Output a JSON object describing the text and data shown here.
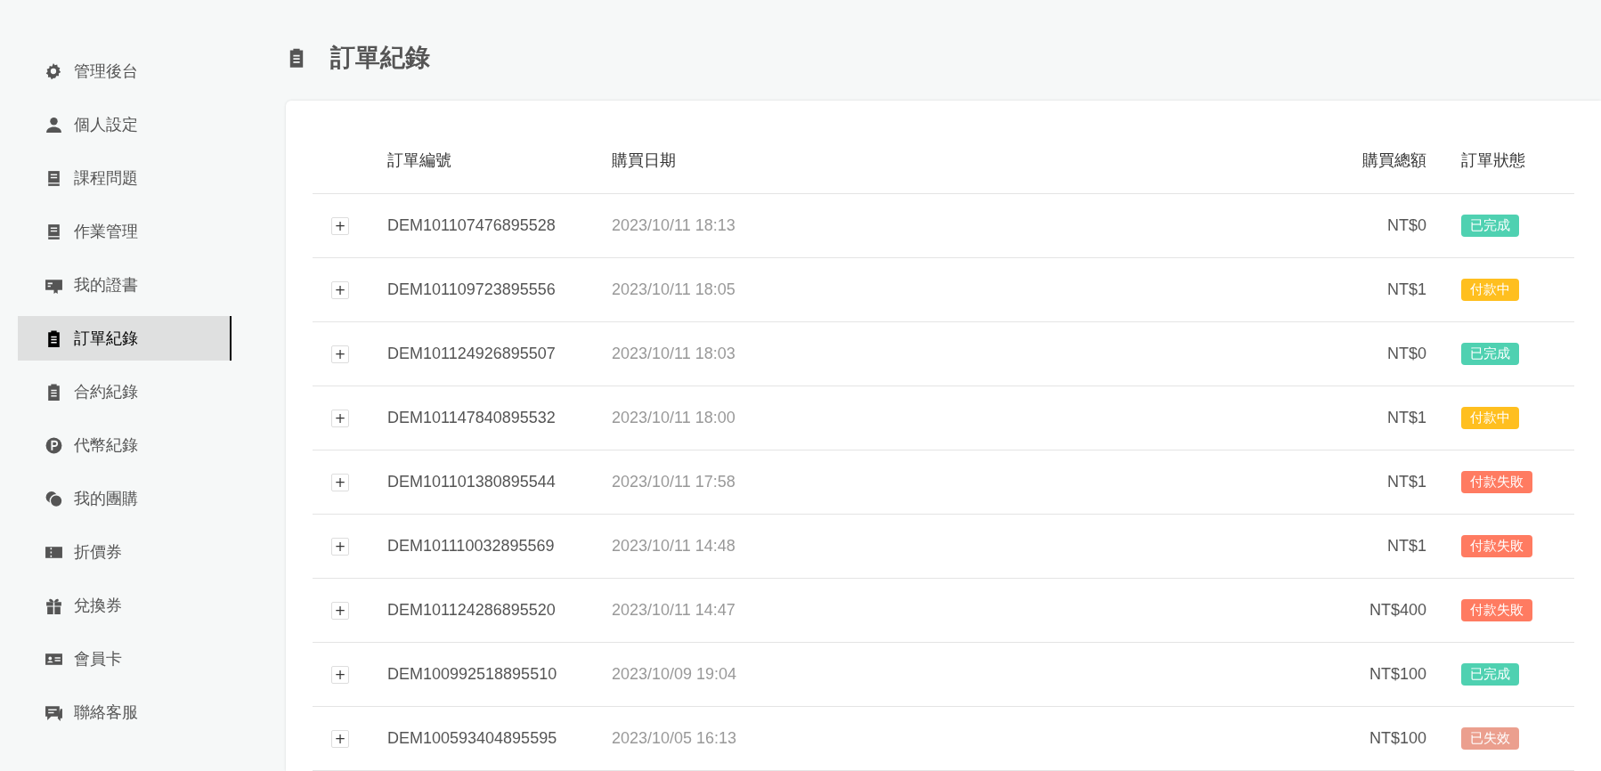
{
  "sidebar": {
    "items": [
      {
        "label": "管理後台",
        "selected": false
      },
      {
        "label": "個人設定",
        "selected": false
      },
      {
        "label": "課程問題",
        "selected": false
      },
      {
        "label": "作業管理",
        "selected": false
      },
      {
        "label": "我的證書",
        "selected": false
      },
      {
        "label": "訂單紀錄",
        "selected": true
      },
      {
        "label": "合約紀錄",
        "selected": false
      },
      {
        "label": "代幣紀錄",
        "selected": false
      },
      {
        "label": "我的團購",
        "selected": false
      },
      {
        "label": "折價券",
        "selected": false
      },
      {
        "label": "兌換券",
        "selected": false
      },
      {
        "label": "會員卡",
        "selected": false
      },
      {
        "label": "聯絡客服",
        "selected": false
      }
    ]
  },
  "page": {
    "title": "訂單紀錄"
  },
  "table": {
    "columns": [
      "訂單編號",
      "購買日期",
      "購買總額",
      "訂單狀態"
    ],
    "rows": [
      {
        "expand": "+",
        "order_no": "DEM101107476895528",
        "date": "2023/10/11 18:13",
        "total": "NT$0",
        "status": {
          "label": "已完成",
          "color": "#4fd1b1"
        }
      },
      {
        "expand": "+",
        "order_no": "DEM101109723895556",
        "date": "2023/10/11 18:05",
        "total": "NT$1",
        "status": {
          "label": "付款中",
          "color": "#ffbf1f"
        }
      },
      {
        "expand": "+",
        "order_no": "DEM101124926895507",
        "date": "2023/10/11 18:03",
        "total": "NT$0",
        "status": {
          "label": "已完成",
          "color": "#4fd1b1"
        }
      },
      {
        "expand": "+",
        "order_no": "DEM101147840895532",
        "date": "2023/10/11 18:00",
        "total": "NT$1",
        "status": {
          "label": "付款中",
          "color": "#ffbf1f"
        }
      },
      {
        "expand": "+",
        "order_no": "DEM101101380895544",
        "date": "2023/10/11 17:58",
        "total": "NT$1",
        "status": {
          "label": "付款失敗",
          "color": "#ff7b61"
        }
      },
      {
        "expand": "+",
        "order_no": "DEM101110032895569",
        "date": "2023/10/11 14:48",
        "total": "NT$1",
        "status": {
          "label": "付款失敗",
          "color": "#ff7b61"
        }
      },
      {
        "expand": "+",
        "order_no": "DEM101124286895520",
        "date": "2023/10/11 14:47",
        "total": "NT$400",
        "status": {
          "label": "付款失敗",
          "color": "#ff7b61"
        }
      },
      {
        "expand": "+",
        "order_no": "DEM100992518895510",
        "date": "2023/10/09 19:04",
        "total": "NT$100",
        "status": {
          "label": "已完成",
          "color": "#4fd1b1"
        }
      },
      {
        "expand": "+",
        "order_no": "DEM100593404895595",
        "date": "2023/10/05 16:13",
        "total": "NT$100",
        "status": {
          "label": "已失效",
          "color": "#eb9f8e"
        }
      }
    ]
  }
}
